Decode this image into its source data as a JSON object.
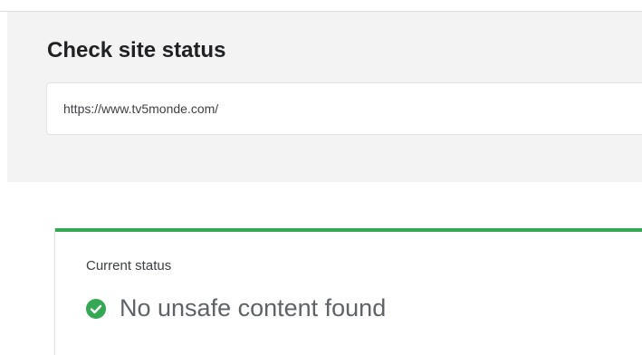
{
  "check": {
    "title": "Check site status",
    "url_value": "https://www.tv5monde.com/"
  },
  "status": {
    "label": "Current status",
    "message": "No unsafe content found",
    "icon": "check-circle-icon",
    "accent_color": "#34a853"
  }
}
